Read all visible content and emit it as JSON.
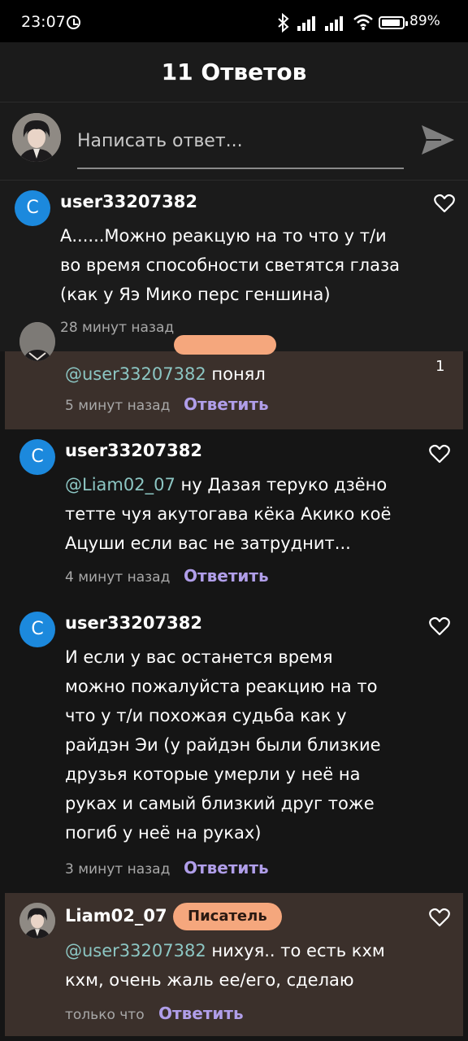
{
  "status_bar": {
    "time": "23:07",
    "battery": "89%",
    "icons": [
      "alarm-icon",
      "bluetooth-icon",
      "signal-icon",
      "signal-icon",
      "wifi-icon",
      "battery-icon"
    ]
  },
  "header": {
    "title": "11 Ответов"
  },
  "compose": {
    "placeholder": "Написать ответ...",
    "send_icon": "send-icon"
  },
  "comments": [
    {
      "username": "user33207382",
      "avatar_letter": "C",
      "text": "А......Можно реакцую на то что у т/и во время способности светятся глаза (как у Яэ Мико перс геншина)",
      "time": "28 минут назад"
    },
    {
      "mention": "@user33207382",
      "text": " понял",
      "time": "5 минут назад",
      "reply": "Ответить",
      "like_count": "1"
    },
    {
      "username": "user33207382",
      "avatar_letter": "C",
      "mention": "@Liam02_07",
      "text": " ну Дазая теруко дзёно тетте чуя акутогава кёка Акико коё Ацуши если вас не затруднит...",
      "time": "4 минут назад",
      "reply": "Ответить"
    },
    {
      "username": "user33207382",
      "avatar_letter": "C",
      "text": "И если у вас останется время можно пожалуйста реакцию на то что у т/и похожая судьба как у райдэн Эи (у райдэн были близкие друзья которые умерли у неё на руках и самый близкий друг тоже погиб у неё на руках)",
      "time": "3 минут назад",
      "reply": "Ответить"
    },
    {
      "username": "Liam02_07",
      "badge": "Писатель",
      "mention": "@user33207382",
      "text": " нихуя.. то есть кхм кхм, очень жаль ее/его, сделаю",
      "time": "только что",
      "reply": "Ответить"
    }
  ],
  "colors": {
    "background": "#151515",
    "highlight": "#3b302b",
    "mention": "#8cc6c3",
    "reply": "#b09ee9",
    "badge": "#f5a77d",
    "avatar": "#1c89dd"
  }
}
